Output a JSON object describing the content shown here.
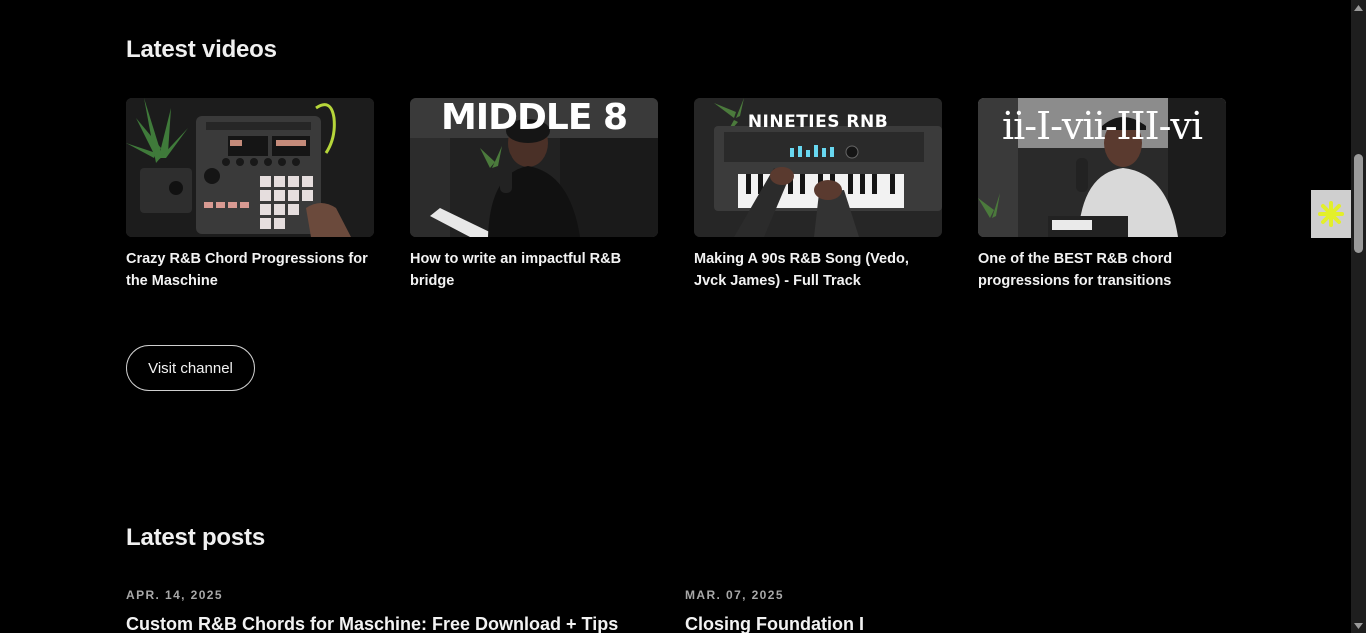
{
  "sections": {
    "videos_title": "Latest videos",
    "posts_title": "Latest posts"
  },
  "videos": [
    {
      "title": "Crazy R&B Chord Progressions for the Maschine",
      "thumb_overlay": "",
      "thumb_icon": "maschine-controller-thumbnail"
    },
    {
      "title": "How to write an impactful R&B bridge",
      "thumb_overlay": "MIDDLE 8",
      "thumb_icon": "presenter-thumbnail"
    },
    {
      "title": "Making A 90s R&B Song (Vedo, Jvck James) - Full Track",
      "thumb_overlay": "NINETIES RNB",
      "thumb_icon": "keyboard-thumbnail"
    },
    {
      "title": "One of the BEST R&B chord progressions for transitions",
      "thumb_overlay": "ii-I-vii-III-vi",
      "thumb_icon": "presenter-thumbnail"
    }
  ],
  "visit_channel_label": "Visit channel",
  "posts": [
    {
      "date": "APR. 14, 2025",
      "title": "Custom R&B Chords for Maschine: Free Download + Tips"
    },
    {
      "date": "MAR. 07, 2025",
      "title": "Closing Foundation I"
    }
  ],
  "colors": {
    "background": "#000000",
    "text": "#f2f2f2",
    "muted": "#a8a8a8",
    "widget_accent": "#e3ef2a"
  }
}
